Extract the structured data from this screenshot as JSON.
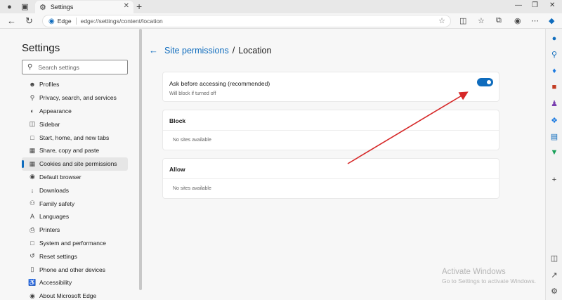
{
  "browser": {
    "tab_title": "Settings",
    "address_brand": "Edge",
    "url": "edge://settings/content/location"
  },
  "settings": {
    "title": "Settings",
    "search_placeholder": "Search settings",
    "nav_items": [
      {
        "label": "Profiles",
        "icon": "profile-icon"
      },
      {
        "label": "Privacy, search, and services",
        "icon": "lock-icon"
      },
      {
        "label": "Appearance",
        "icon": "appearance-icon"
      },
      {
        "label": "Sidebar",
        "icon": "sidebar-icon"
      },
      {
        "label": "Start, home, and new tabs",
        "icon": "home-icon"
      },
      {
        "label": "Share, copy and paste",
        "icon": "share-icon"
      },
      {
        "label": "Cookies and site permissions",
        "icon": "cookies-icon",
        "active": true
      },
      {
        "label": "Default browser",
        "icon": "browser-icon"
      },
      {
        "label": "Downloads",
        "icon": "download-icon"
      },
      {
        "label": "Family safety",
        "icon": "family-icon"
      },
      {
        "label": "Languages",
        "icon": "languages-icon"
      },
      {
        "label": "Printers",
        "icon": "printer-icon"
      },
      {
        "label": "System and performance",
        "icon": "system-icon"
      },
      {
        "label": "Reset settings",
        "icon": "reset-icon"
      },
      {
        "label": "Phone and other devices",
        "icon": "phone-icon"
      },
      {
        "label": "Accessibility",
        "icon": "accessibility-icon"
      },
      {
        "label": "About Microsoft Edge",
        "icon": "edge-icon"
      }
    ]
  },
  "main": {
    "breadcrumb_parent": "Site permissions",
    "breadcrumb_separator": "/",
    "breadcrumb_current": "Location",
    "ask_title": "Ask before accessing (recommended)",
    "ask_subtitle": "Will block if turned off",
    "ask_toggle_on": true,
    "block_header": "Block",
    "block_empty": "No sites available",
    "allow_header": "Allow",
    "allow_empty": "No sites available"
  },
  "watermark": {
    "line1": "Activate Windows",
    "line2": "Go to Settings to activate Windows."
  },
  "colors": {
    "accent": "#0f6cbd",
    "annotation_arrow": "#d62828"
  }
}
